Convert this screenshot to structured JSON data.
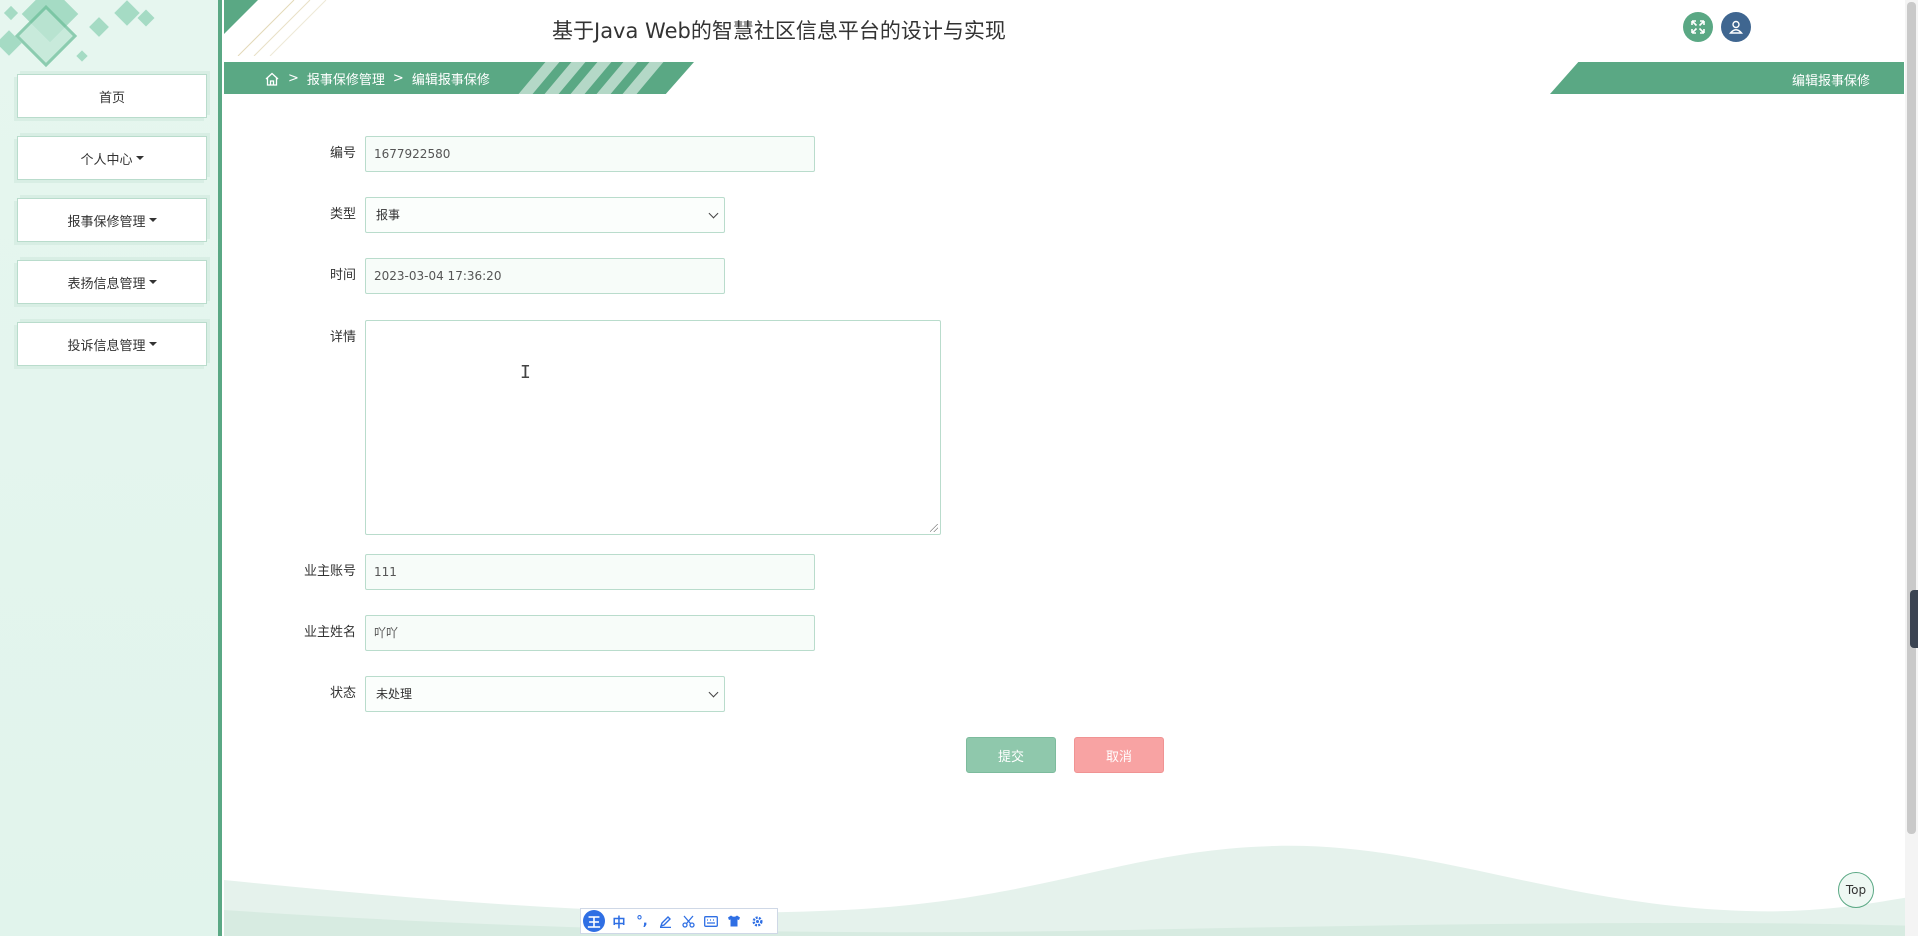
{
  "app": {
    "title": "基于Java Web的智慧社区信息平台的设计与实现"
  },
  "sidebar": {
    "items": [
      {
        "label": "首页",
        "has_caret": false
      },
      {
        "label": "个人中心",
        "has_caret": true
      },
      {
        "label": "报事保修管理",
        "has_caret": true
      },
      {
        "label": "表扬信息管理",
        "has_caret": true
      },
      {
        "label": "投诉信息管理",
        "has_caret": true
      }
    ]
  },
  "breadcrumb": {
    "home_icon": "home-icon",
    "separator": ">",
    "items": [
      "报事保修管理",
      "编辑报事保修"
    ]
  },
  "page_tag": "编辑报事保修",
  "header_icons": [
    "fullscreen-icon",
    "user-icon"
  ],
  "form": {
    "fields": {
      "number": {
        "label": "编号",
        "value": "1677922580"
      },
      "type": {
        "label": "类型",
        "value": "报事"
      },
      "time": {
        "label": "时间",
        "value": "2023-03-04 17:36:20"
      },
      "details": {
        "label": "详情",
        "value": ""
      },
      "owner_account": {
        "label": "业主账号",
        "value": "111"
      },
      "owner_name": {
        "label": "业主姓名",
        "value": "吖吖"
      },
      "status": {
        "label": "状态",
        "value": "未处理"
      }
    },
    "submit_label": "提交",
    "cancel_label": "取消"
  },
  "top_button": "Top",
  "ime": {
    "logo": "王",
    "mode": "中",
    "punct": "°,",
    "icons": [
      "pen-icon",
      "scissors-icon",
      "keyboard-icon",
      "shirt-icon",
      "gear-icon"
    ]
  },
  "colors": {
    "accent": "#5aa884",
    "sidebar_bg": "#e1f4ec",
    "submit": "#8fc8ac",
    "cancel": "#f8a3a3",
    "user_icon_bg": "#3f6690"
  }
}
